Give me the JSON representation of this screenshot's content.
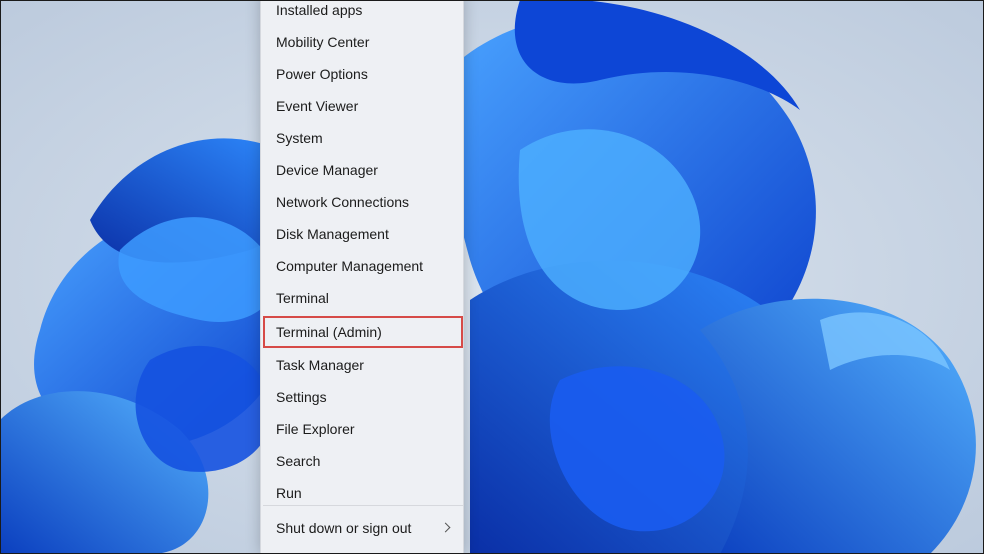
{
  "desktop": {
    "wallpaper_icon": "windows-bloom-wallpaper",
    "colors": {
      "background": "#c7d3e3",
      "bloom": "#1e63e6",
      "highlight_border": "#d64a47"
    }
  },
  "context_menu": {
    "items": [
      {
        "label": "Installed apps"
      },
      {
        "label": "Mobility Center"
      },
      {
        "label": "Power Options"
      },
      {
        "label": "Event Viewer"
      },
      {
        "label": "System"
      },
      {
        "label": "Device Manager"
      },
      {
        "label": "Network Connections"
      },
      {
        "label": "Disk Management"
      },
      {
        "label": "Computer Management"
      },
      {
        "label": "Terminal"
      },
      {
        "label": "Terminal (Admin)",
        "highlighted": true
      },
      {
        "label": "Task Manager"
      },
      {
        "label": "Settings"
      },
      {
        "label": "File Explorer"
      },
      {
        "label": "Search"
      },
      {
        "label": "Run"
      },
      {
        "label": "Shut down or sign out",
        "submenu_icon": "chevron-right-icon"
      }
    ]
  }
}
